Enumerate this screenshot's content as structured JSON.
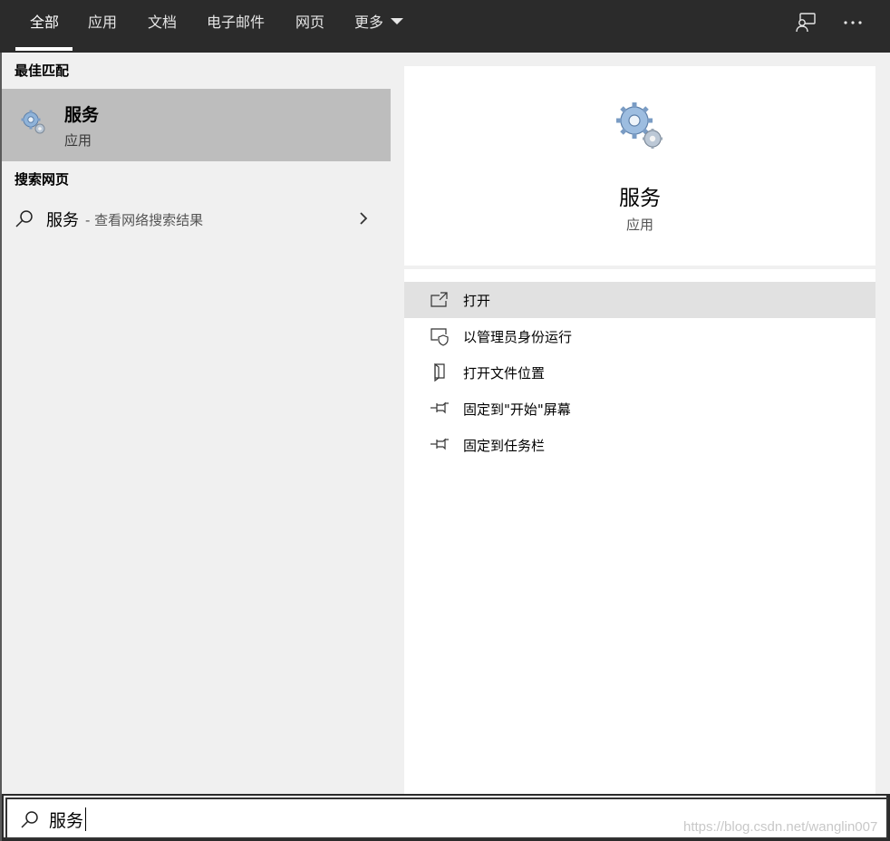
{
  "tabs": [
    {
      "label": "全部",
      "active": true
    },
    {
      "label": "应用"
    },
    {
      "label": "文档"
    },
    {
      "label": "电子邮件"
    },
    {
      "label": "网页"
    },
    {
      "label": "更多"
    }
  ],
  "top_icons": [
    "feedback-icon",
    "more-options-icon"
  ],
  "left": {
    "best_match_header": "最佳匹配",
    "best_match": {
      "title": "服务",
      "subtitle": "应用",
      "icon": "services-gear-icon"
    },
    "web_header": "搜索网页",
    "web_result": {
      "query": "服务",
      "hint": "- 查看网络搜索结果"
    }
  },
  "preview": {
    "title": "服务",
    "subtitle": "应用",
    "icon": "services-gear-icon"
  },
  "actions": [
    {
      "label": "打开",
      "icon": "open-icon",
      "highlighted": true
    },
    {
      "label": "以管理员身份运行",
      "icon": "run-as-admin-icon"
    },
    {
      "label": "打开文件位置",
      "icon": "file-location-icon"
    },
    {
      "label": "固定到\"开始\"屏幕",
      "icon": "pin-icon"
    },
    {
      "label": "固定到任务栏",
      "icon": "pin-icon"
    }
  ],
  "search": {
    "value": "服务",
    "icon": "search-icon"
  },
  "watermark": "https://blog.csdn.net/wanglin007",
  "colors": {
    "topbar": "#2b2b2b",
    "pane": "#f0f0f0",
    "selected": "#bdbdbd",
    "hover": "#e1e1e1"
  }
}
